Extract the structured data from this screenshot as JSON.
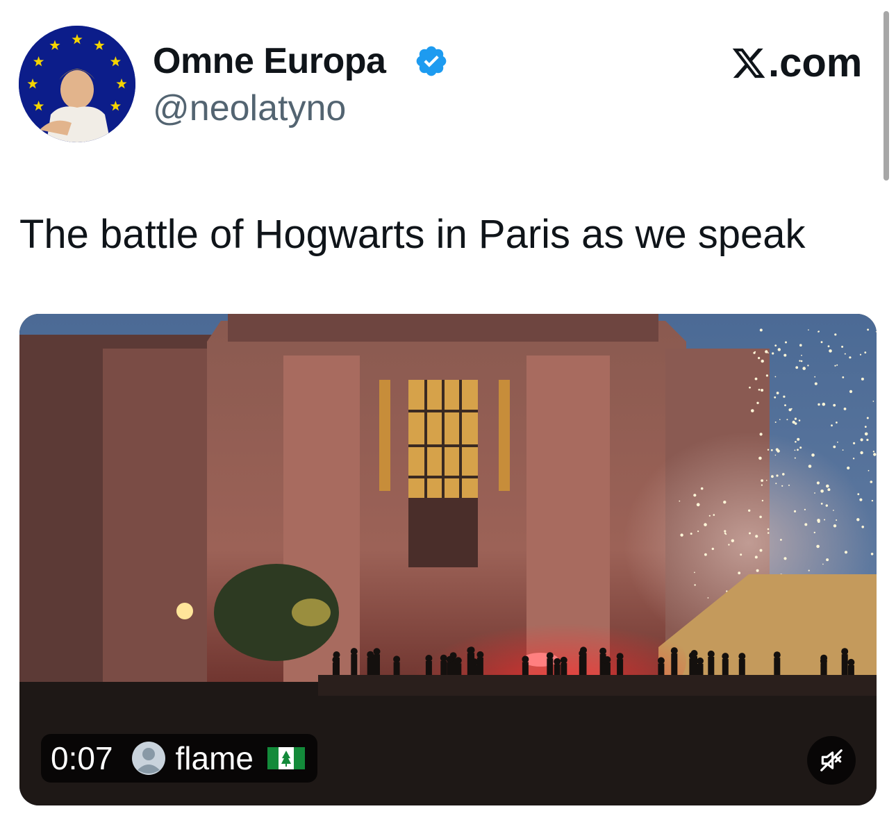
{
  "author": {
    "name": "Omne Europa",
    "handle": "@neolatyno",
    "verified": true,
    "verified_color": "#1d9bf0"
  },
  "brand": {
    "label": ".com",
    "icon": "x-logo-icon"
  },
  "tweet": {
    "text": "The battle of Hogwarts in Paris as we speak"
  },
  "video": {
    "duration": "0:07",
    "uploader": "flame",
    "uploader_icon": "user-avatar-icon",
    "flag_icon": "norfolk-island-flag-icon",
    "mute_icon": "speaker-muted-icon"
  },
  "colors": {
    "text": "#0f1419",
    "secondary_text": "#536471",
    "avatar_bg": "#0c1d8a",
    "avatar_stars": "#f5d400"
  }
}
